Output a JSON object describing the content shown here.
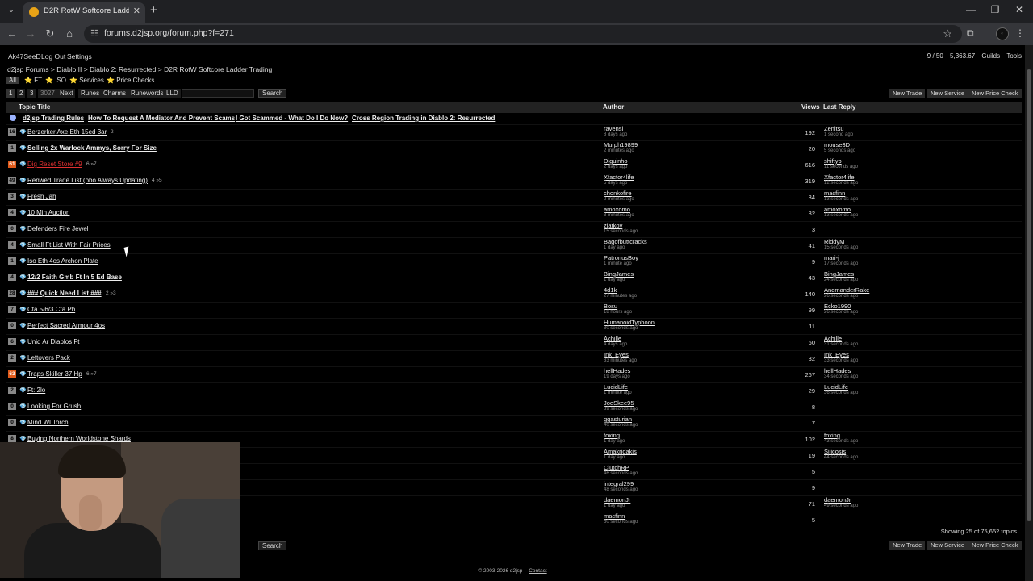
{
  "browser": {
    "tab_title": "D2R RotW Softcore Ladder Tra",
    "url": "forums.d2jsp.org/forum.php?f=271"
  },
  "userbar": {
    "username": "Ak47SeeD",
    "logout": "Log Out",
    "settings": "Settings",
    "slots": "9 / 50",
    "gold": "5,363.67",
    "guilds": "Guilds",
    "tools": "Tools"
  },
  "breadcrumb": [
    "d2jsp Forums",
    "Diablo II",
    "Diablo 2: Resurrected",
    "D2R RotW Softcore Ladder Trading"
  ],
  "breadcrumb_sep": ">",
  "filters": [
    "All",
    "FT",
    "ISO",
    "Services",
    "Price Checks"
  ],
  "pager": {
    "pages": [
      "1",
      "2",
      "3",
      "3027"
    ],
    "next": "Next",
    "categories": [
      "Runes",
      "Charms",
      "Runewords",
      "LLD"
    ],
    "search": "Search"
  },
  "actions": {
    "new_trade": "New Trade",
    "new_service": "New Service",
    "new_price_check": "New Price Check"
  },
  "table_headers": {
    "topic": "Topic Title",
    "author": "Author",
    "views": "Views",
    "last_reply": "Last Reply"
  },
  "sticky_links": [
    "d2jsp Trading Rules",
    "How To Request A Mediator And Prevent Scams",
    "I Got Scammed - What Do I Do Now?",
    "Cross Region Trading in Diablo 2: Resurrected"
  ],
  "rows": [
    {
      "rep": "16",
      "hot": false,
      "title": "Berzerker Axe Eth 15ed 3ar",
      "pages": "2",
      "bold": false,
      "red": false,
      "author": "ravensl",
      "atime": "8 days ago",
      "views": "192",
      "lr": "Zenitsu",
      "lrtime": "1 second ago"
    },
    {
      "rep": "1",
      "hot": false,
      "title": "Selling 2x Warlock Ammys, Sorry For Size",
      "pages": "",
      "bold": true,
      "red": false,
      "author": "Murph19899",
      "atime": "2 minutes ago",
      "views": "20",
      "lr": "mouse3D",
      "lrtime": "5 seconds ago"
    },
    {
      "rep": "61",
      "hot": true,
      "title": "Dig Reset Store #9",
      "pages": "6 »7",
      "bold": false,
      "red": true,
      "author": "Diguinho",
      "atime": "2 days ago",
      "views": "616",
      "lr": "shiftyb",
      "lrtime": "11 seconds ago"
    },
    {
      "rep": "49",
      "hot": false,
      "title": "Renwed Trade List (obo Always Updating)",
      "pages": "4 »5",
      "bold": false,
      "red": false,
      "author": "Xfactor4life",
      "atime": "5 days ago",
      "views": "319",
      "lr": "Xfactor4life",
      "lrtime": "12 seconds ago"
    },
    {
      "rep": "3",
      "hot": false,
      "title": "Fresh Jah",
      "pages": "",
      "bold": false,
      "red": false,
      "author": "chonkofire",
      "atime": "2 minutes ago",
      "views": "34",
      "lr": "macfinn",
      "lrtime": "13 seconds ago"
    },
    {
      "rep": "4",
      "hot": false,
      "title": "10 Min Auction",
      "pages": "",
      "bold": false,
      "red": false,
      "author": "amoxomo",
      "atime": "3 minutes ago",
      "views": "32",
      "lr": "amoxomo",
      "lrtime": "13 seconds ago"
    },
    {
      "rep": "0",
      "hot": false,
      "title": "Defenders Fire Jewel",
      "pages": "",
      "bold": false,
      "red": false,
      "author": "zlatkov",
      "atime": "15 seconds ago",
      "views": "3",
      "lr": "",
      "lrtime": ""
    },
    {
      "rep": "4",
      "hot": false,
      "title": "Small Ft List With Fair Prices",
      "pages": "",
      "bold": false,
      "red": false,
      "author": "Bagofbuttcracks",
      "atime": "1 day ago",
      "views": "41",
      "lr": "RiddyM",
      "lrtime": "15 seconds ago"
    },
    {
      "rep": "1",
      "hot": false,
      "title": "Iso Eth 4os Archon Plate",
      "pages": "",
      "bold": false,
      "red": false,
      "author": "PatronusBoy",
      "atime": "1 minute ago",
      "views": "9",
      "lr": "mari-j",
      "lrtime": "17 seconds ago"
    },
    {
      "rep": "4",
      "hot": false,
      "title": "12/2 Faith Gmb Ft In 5 Ed Base",
      "pages": "",
      "bold": true,
      "red": false,
      "author": "BingJames",
      "atime": "1 day ago",
      "views": "43",
      "lr": "BingJames",
      "lrtime": "24 seconds ago"
    },
    {
      "rep": "28",
      "hot": false,
      "title": "### Quick Need List ###",
      "pages": "2 »3",
      "bold": true,
      "red": false,
      "author": "4d1k",
      "atime": "27 minutes ago",
      "views": "140",
      "lr": "AnomanderRake",
      "lrtime": "26 seconds ago"
    },
    {
      "rep": "7",
      "hot": false,
      "title": "Cta 5/6/3 Cta Pb",
      "pages": "",
      "bold": false,
      "red": false,
      "author": "Bosu",
      "atime": "18 hours ago",
      "views": "99",
      "lr": "Ecko1990",
      "lrtime": "26 seconds ago"
    },
    {
      "rep": "0",
      "hot": false,
      "title": "Perfect Sacred Armour 4os",
      "pages": "",
      "bold": false,
      "red": false,
      "author": "HumanoidTyphoon",
      "atime": "30 seconds ago",
      "views": "11",
      "lr": "",
      "lrtime": ""
    },
    {
      "rep": "6",
      "hot": false,
      "title": "Unid Ar Diablos Ft",
      "pages": "",
      "bold": false,
      "red": false,
      "author": "Achille",
      "atime": "4 days ago",
      "views": "60",
      "lr": "Achille",
      "lrtime": "31 seconds ago"
    },
    {
      "rep": "2",
      "hot": false,
      "title": "Leftovers Pack",
      "pages": "",
      "bold": false,
      "red": false,
      "author": "Ink_Eyes",
      "atime": "33 minutes ago",
      "views": "32",
      "lr": "Ink_Eyes",
      "lrtime": "33 seconds ago"
    },
    {
      "rep": "63",
      "hot": true,
      "title": "Traps Skiller 37 Hp",
      "pages": "6 »7",
      "bold": false,
      "red": false,
      "author": "hellHades",
      "atime": "19 days ago",
      "views": "267",
      "lr": "hellHades",
      "lrtime": "34 seconds ago"
    },
    {
      "rep": "2",
      "hot": false,
      "title": "Ft: 2lo",
      "pages": "",
      "bold": false,
      "red": false,
      "author": "LucidLife",
      "atime": "1 minute ago",
      "views": "29",
      "lr": "LucidLife",
      "lrtime": "36 seconds ago"
    },
    {
      "rep": "0",
      "hot": false,
      "title": "Looking For Grush",
      "pages": "",
      "bold": false,
      "red": false,
      "author": "JoeSkee95",
      "atime": "39 seconds ago",
      "views": "8",
      "lr": "",
      "lrtime": ""
    },
    {
      "rep": "0",
      "hot": false,
      "title": "Mind Wl Torch",
      "pages": "",
      "bold": false,
      "red": false,
      "author": "ggasturian",
      "atime": "40 seconds ago",
      "views": "7",
      "lr": "",
      "lrtime": ""
    },
    {
      "rep": "8",
      "hot": false,
      "title": "Buying Northern Worldstone Shards",
      "pages": "",
      "bold": false,
      "red": false,
      "author": "foxing",
      "atime": "1 day ago",
      "views": "102",
      "lr": "foxing",
      "lrtime": "43 seconds ago"
    },
    {
      "rep": "",
      "hot": false,
      "title": "",
      "pages": "",
      "bold": false,
      "red": false,
      "author": "Amakridakis",
      "atime": "1 day ago",
      "views": "19",
      "lr": "Silicosis",
      "lrtime": "44 seconds ago"
    },
    {
      "rep": "",
      "hot": false,
      "title": "",
      "pages": "",
      "bold": false,
      "red": false,
      "author": "ClutchRP",
      "atime": "46 seconds ago",
      "views": "5",
      "lr": "",
      "lrtime": ""
    },
    {
      "rep": "",
      "hot": false,
      "title": "",
      "pages": "",
      "bold": false,
      "red": false,
      "author": "integral299",
      "atime": "48 seconds ago",
      "views": "9",
      "lr": "",
      "lrtime": ""
    },
    {
      "rep": "",
      "hot": false,
      "title": "",
      "pages": "",
      "bold": false,
      "red": false,
      "author": "daemonJr",
      "atime": "1 day ago",
      "views": "71",
      "lr": "daemonJr",
      "lrtime": "49 seconds ago"
    },
    {
      "rep": "",
      "hot": false,
      "title": "",
      "pages": "",
      "bold": false,
      "red": false,
      "author": "macfinn",
      "atime": "50 seconds ago",
      "views": "5",
      "lr": "",
      "lrtime": ""
    }
  ],
  "showing": "Showing 25 of 75,652 topics",
  "footer": {
    "copyright": "© 2003-2026 d2jsp",
    "contact": "Contact"
  },
  "colors": {
    "hot_rep": "#e05a1a",
    "red_topic": "#e03030",
    "page_bg": "#000000"
  }
}
